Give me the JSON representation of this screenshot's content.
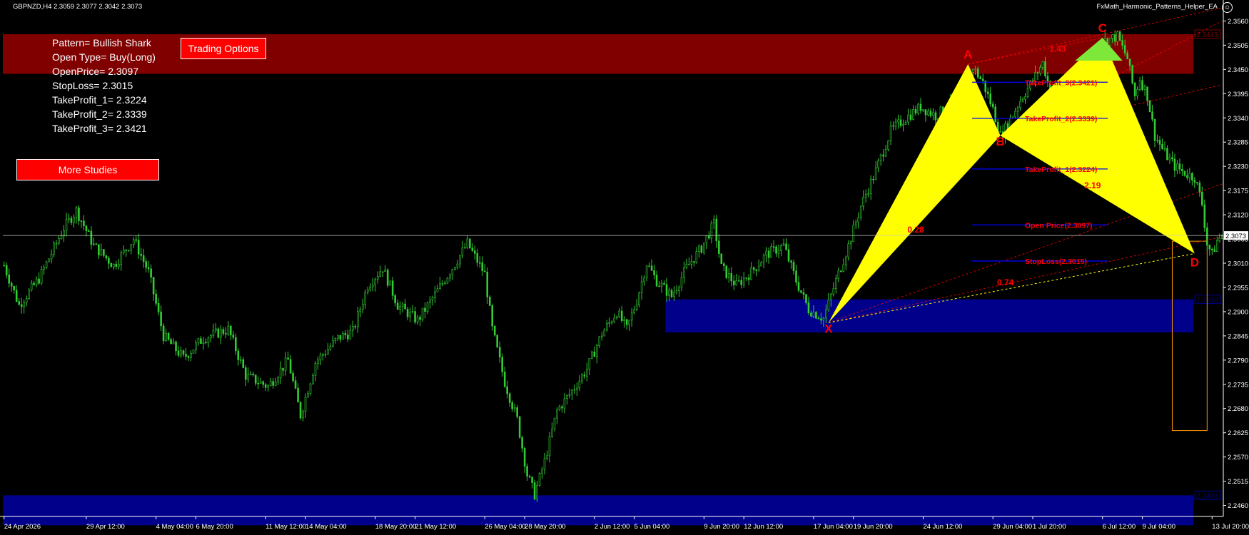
{
  "header": {
    "symbol_info": "GBPNZD,H4  2.3059 2.3077 2.3042 2.3073",
    "ea_name": "FxMath_Harmonic_Patterns_Helper_EA",
    "smiley": "☺"
  },
  "info_panel": {
    "lines": [
      "Pattern= Bullish Shark",
      "Open Type= Buy(Long)",
      "OpenPrice= 2.3097",
      "StopLoss= 2.3015",
      "TakeProfit_1= 2.3224",
      "TakeProfit_2= 2.3339",
      "TakeProfit_3= 2.3421"
    ]
  },
  "buttons": {
    "trading_options": "Trading Options",
    "more_studies": "More Studies"
  },
  "colors": {
    "background": "#000000",
    "candle": "#32cd32",
    "pattern_fill": "#ffff00",
    "pattern_green": "#7ee83a",
    "supply_zone": "#800000",
    "demand_zone": "#00008b",
    "label_red": "#ff0000",
    "level_line": "#0000ff",
    "projection_box": "#ff9900",
    "axis_text": "#ffffff"
  },
  "chart_data": {
    "type": "candlestick",
    "symbol": "GBPNZD",
    "timeframe": "H4",
    "ylim": [
      2.2435,
      2.3585
    ],
    "y_ticks": [
      "2.3560",
      "2.3505",
      "2.3450",
      "2.3395",
      "2.3340",
      "2.3285",
      "2.3230",
      "2.3175",
      "2.3120",
      "2.3065",
      "2.3010",
      "2.2955",
      "2.2900",
      "2.2845",
      "2.2790",
      "2.2735",
      "2.2680",
      "2.2625",
      "2.2570",
      "2.2515",
      "2.2460"
    ],
    "x_ticks": [
      {
        "label": "24 Apr 2026",
        "bar": 0
      },
      {
        "label": "29 Apr 12:00",
        "bar": 33
      },
      {
        "label": "4 May 04:00",
        "bar": 61
      },
      {
        "label": "6 May 20:00",
        "bar": 77
      },
      {
        "label": "11 May 12:00",
        "bar": 105
      },
      {
        "label": "14 May 04:00",
        "bar": 121
      },
      {
        "label": "18 May 20:00",
        "bar": 149
      },
      {
        "label": "21 May 12:00",
        "bar": 165
      },
      {
        "label": "26 May 04:00",
        "bar": 193
      },
      {
        "label": "28 May 20:00",
        "bar": 209
      },
      {
        "label": "2 Jun 12:00",
        "bar": 237
      },
      {
        "label": "5 Jun 04:00",
        "bar": 253
      },
      {
        "label": "9 Jun 20:00",
        "bar": 281
      },
      {
        "label": "12 Jun 12:00",
        "bar": 297
      },
      {
        "label": "17 Jun 04:00",
        "bar": 325
      },
      {
        "label": "19 Jun 20:00",
        "bar": 341
      },
      {
        "label": "24 Jun 12:00",
        "bar": 369
      },
      {
        "label": "29 Jun 04:00",
        "bar": 397
      },
      {
        "label": "1 Jul 20:00",
        "bar": 413
      },
      {
        "label": "6 Jul 12:00",
        "bar": 441
      },
      {
        "label": "9 Jul 04:00",
        "bar": 457
      },
      {
        "label": "13 Jul 20:00",
        "bar": 485
      }
    ],
    "total_bars": 490,
    "price_path": [
      [
        0,
        2.3005
      ],
      [
        6,
        2.2915
      ],
      [
        14,
        2.2975
      ],
      [
        24,
        2.309
      ],
      [
        29,
        2.313
      ],
      [
        36,
        2.305
      ],
      [
        44,
        2.3005
      ],
      [
        52,
        2.3065
      ],
      [
        58,
        2.299
      ],
      [
        64,
        2.2845
      ],
      [
        72,
        2.2795
      ],
      [
        80,
        2.284
      ],
      [
        90,
        2.286
      ],
      [
        97,
        2.2755
      ],
      [
        106,
        2.273
      ],
      [
        114,
        2.279
      ],
      [
        119,
        2.2665
      ],
      [
        125,
        2.2785
      ],
      [
        134,
        2.284
      ],
      [
        140,
        2.2855
      ],
      [
        146,
        2.296
      ],
      [
        152,
        2.3
      ],
      [
        158,
        2.2915
      ],
      [
        166,
        2.288
      ],
      [
        172,
        2.293
      ],
      [
        180,
        2.3
      ],
      [
        186,
        2.3055
      ],
      [
        193,
        2.2985
      ],
      [
        196,
        2.286
      ],
      [
        201,
        2.274
      ],
      [
        206,
        2.2655
      ],
      [
        210,
        2.253
      ],
      [
        213,
        2.2485
      ],
      [
        217,
        2.256
      ],
      [
        222,
        2.2675
      ],
      [
        228,
        2.272
      ],
      [
        234,
        2.277
      ],
      [
        240,
        2.285
      ],
      [
        246,
        2.29
      ],
      [
        250,
        2.286
      ],
      [
        254,
        2.2925
      ],
      [
        258,
        2.301
      ],
      [
        262,
        2.297
      ],
      [
        268,
        2.2935
      ],
      [
        274,
        2.3
      ],
      [
        280,
        2.3045
      ],
      [
        285,
        2.31
      ],
      [
        288,
        2.3
      ],
      [
        294,
        2.296
      ],
      [
        300,
        2.299
      ],
      [
        306,
        2.303
      ],
      [
        313,
        2.305
      ],
      [
        318,
        2.297
      ],
      [
        323,
        2.2905
      ],
      [
        329,
        2.2885
      ],
      [
        334,
        2.297
      ],
      [
        339,
        2.305
      ],
      [
        344,
        2.314
      ],
      [
        350,
        2.322
      ],
      [
        356,
        2.331
      ],
      [
        362,
        2.334
      ],
      [
        368,
        2.3365
      ],
      [
        374,
        2.3345
      ],
      [
        380,
        2.337
      ],
      [
        386,
        2.3415
      ],
      [
        389,
        2.3455
      ],
      [
        393,
        2.342
      ],
      [
        397,
        2.336
      ],
      [
        400,
        2.33
      ],
      [
        403,
        2.3325
      ],
      [
        408,
        2.338
      ],
      [
        413,
        2.3425
      ],
      [
        417,
        2.3465
      ],
      [
        421,
        2.338
      ],
      [
        425,
        2.336
      ],
      [
        430,
        2.342
      ],
      [
        434,
        2.346
      ],
      [
        438,
        2.35
      ],
      [
        442,
        2.3515
      ],
      [
        447,
        2.3525
      ],
      [
        451,
        2.3475
      ],
      [
        454,
        2.339
      ],
      [
        456,
        2.343
      ],
      [
        459,
        2.339
      ],
      [
        462,
        2.33
      ],
      [
        466,
        2.326
      ],
      [
        470,
        2.323
      ],
      [
        474,
        2.3215
      ],
      [
        478,
        2.3205
      ],
      [
        481,
        2.3145
      ],
      [
        483,
        2.3055
      ],
      [
        485,
        2.303
      ],
      [
        487,
        2.306
      ],
      [
        489,
        2.3073
      ]
    ],
    "current_price": "2.3073",
    "pattern": {
      "name": "Bullish Shark",
      "points": [
        {
          "label": "X",
          "bar": 331,
          "price": 2.2875
        },
        {
          "label": "A",
          "bar": 387,
          "price": 2.3462
        },
        {
          "label": "B",
          "bar": 400,
          "price": 2.33
        },
        {
          "label": "C",
          "bar": 441,
          "price": 2.3522
        },
        {
          "label": "D",
          "bar": 478,
          "price": 2.3032
        }
      ],
      "ratios": [
        {
          "text": "0.28",
          "bar": 366,
          "price": 2.308
        },
        {
          "text": "1.43",
          "bar": 423,
          "price": 2.349
        },
        {
          "text": "2.19",
          "bar": 437,
          "price": 2.318
        },
        {
          "text": "0.74",
          "bar": 402,
          "price": 2.296
        }
      ]
    },
    "zones": [
      {
        "name": "supply",
        "bar_start": 0,
        "bar_end": 477,
        "top": 2.353,
        "bottom": 2.344,
        "color": "#800000",
        "label": "2.3443"
      },
      {
        "name": "demand-upper",
        "bar_start": 266,
        "bar_end": 477,
        "top": 2.2928,
        "bottom": 2.2853,
        "color": "#00008b",
        "label": "2.2928"
      },
      {
        "name": "demand-lower",
        "bar_start": 0,
        "bar_end": 477,
        "top": 2.2483,
        "bottom": 2.2415,
        "color": "#00008b",
        "label": "2.2483"
      }
    ],
    "levels": [
      {
        "label": "TakeProfit_3(2.3421)",
        "price": 2.3421
      },
      {
        "label": "TakeProfit_2(2.3339)",
        "price": 2.3339
      },
      {
        "label": "TakeProfit_1(2.3224)",
        "price": 2.3224
      },
      {
        "label": "Open Price(2.3097)",
        "price": 2.3097
      },
      {
        "label": "StopLoss(2.3015)",
        "price": 2.3015
      }
    ],
    "projection_box": {
      "bar_start": 469,
      "bar_end": 483,
      "top": 2.306,
      "bottom": 2.263
    },
    "channels": [
      {
        "from": [
          387,
          2.3462
        ],
        "to": [
          489,
          2.359
        ]
      },
      {
        "from": [
          400,
          2.33
        ],
        "to": [
          489,
          2.356
        ]
      },
      {
        "from": [
          400,
          2.33
        ],
        "to": [
          489,
          2.3415
        ]
      },
      {
        "from": [
          331,
          2.2875
        ],
        "to": [
          489,
          2.319
        ]
      },
      {
        "from": [
          331,
          2.2875
        ],
        "to": [
          489,
          2.307
        ]
      }
    ]
  }
}
